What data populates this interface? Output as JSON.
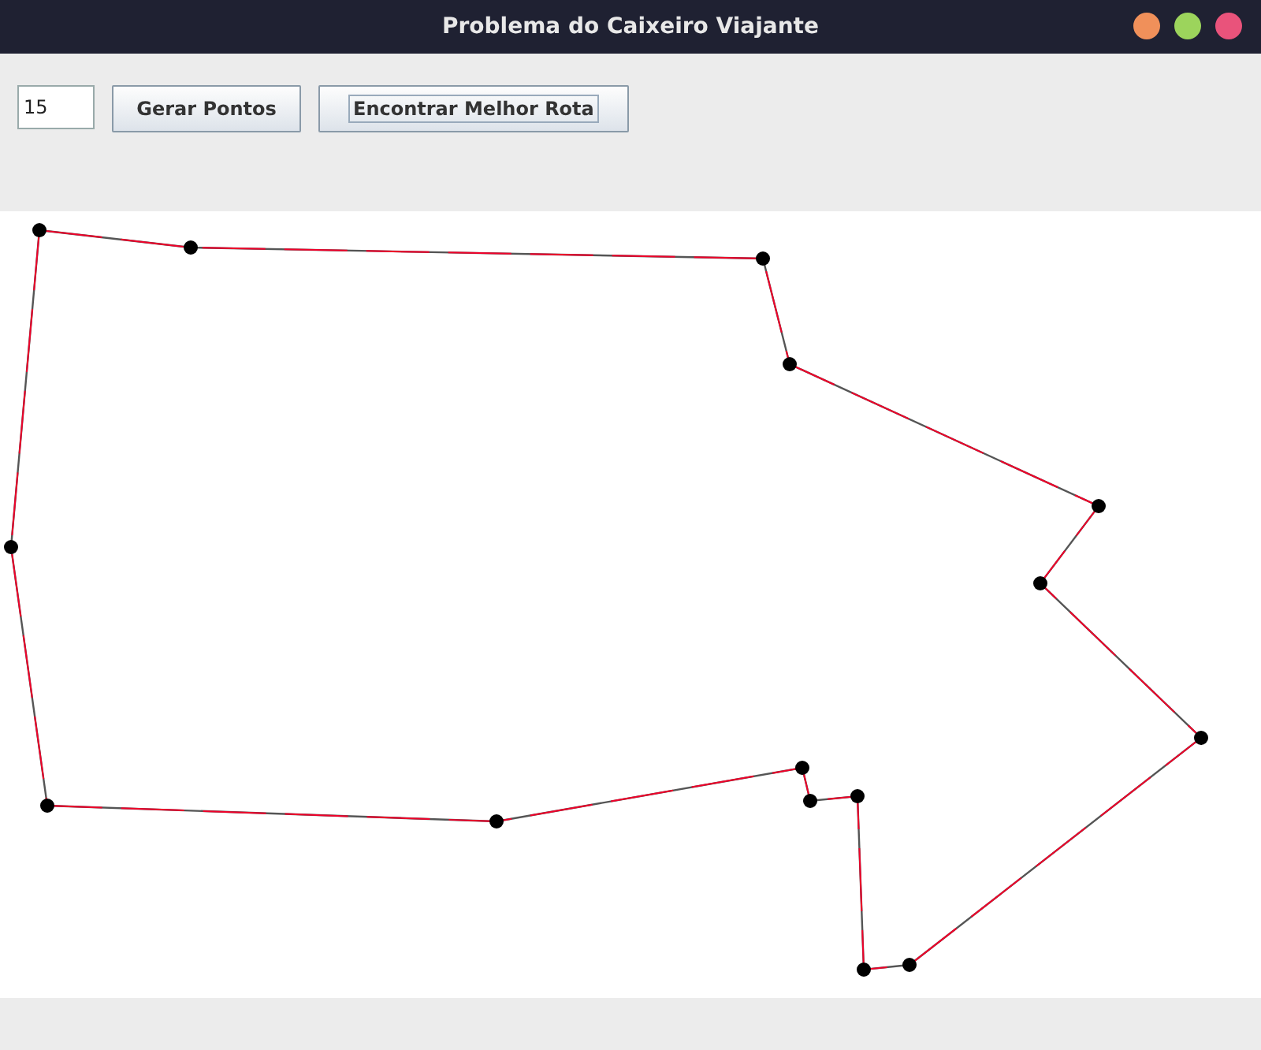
{
  "window": {
    "title": "Problema do Caixeiro Viajante"
  },
  "toolbar": {
    "points_field": {
      "value": "15"
    },
    "buttons": [
      {
        "label": "Gerar Pontos",
        "focused": false
      },
      {
        "label": "Encontrar Melhor Rota",
        "focused": true
      }
    ]
  }
}
